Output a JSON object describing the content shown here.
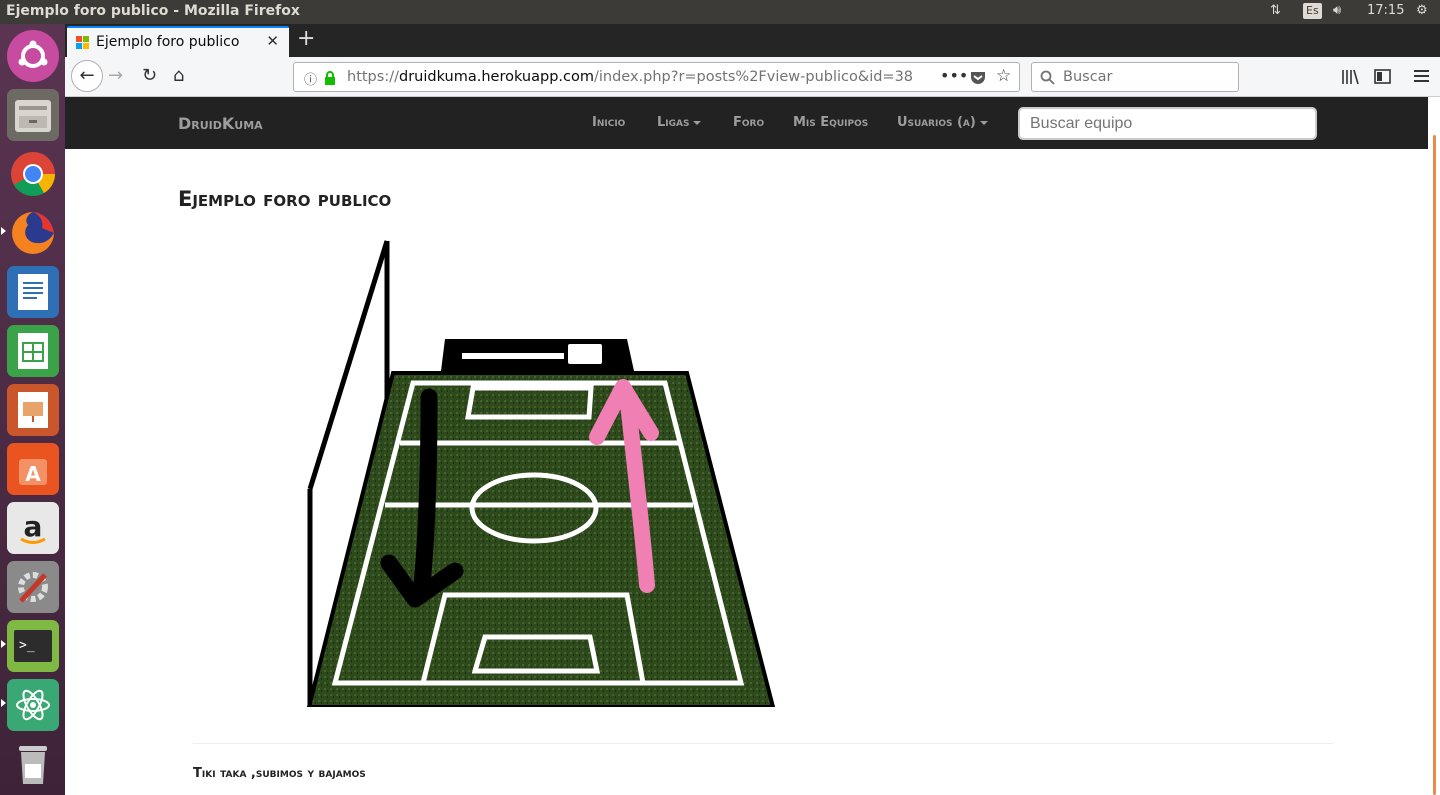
{
  "system": {
    "window_title": "Ejemplo foro publico - Mozilla Firefox",
    "keyboard": "Es",
    "clock": "17:15"
  },
  "launcher": [
    "ubuntu-dash",
    "files",
    "chrome",
    "firefox",
    "writer",
    "calc",
    "impress",
    "software-center",
    "amazon",
    "system-settings",
    "terminal",
    "atom",
    "trash"
  ],
  "browser": {
    "tab_title": "Ejemplo foro publico",
    "url_https": "https://",
    "url_host": "druidkuma.herokuapp.com",
    "url_path": "/index.php?r=posts%2Fview-publico&id=38",
    "search_placeholder": "Buscar"
  },
  "site": {
    "brand": "DruidKuma",
    "nav": [
      "Inicio",
      "Ligas",
      "Foro",
      "Mis Equipos",
      "Usuarios (a)"
    ],
    "search_placeholder": "Buscar equipo"
  },
  "post": {
    "title": "Ejemplo foro publico",
    "body": "Tiki taka ,subimos y bajamos"
  },
  "colors": {
    "accent": "#0a84ff",
    "navbar": "#222222",
    "arrow_pink": "#f07fb4",
    "scroll": "#ea8a4e"
  }
}
